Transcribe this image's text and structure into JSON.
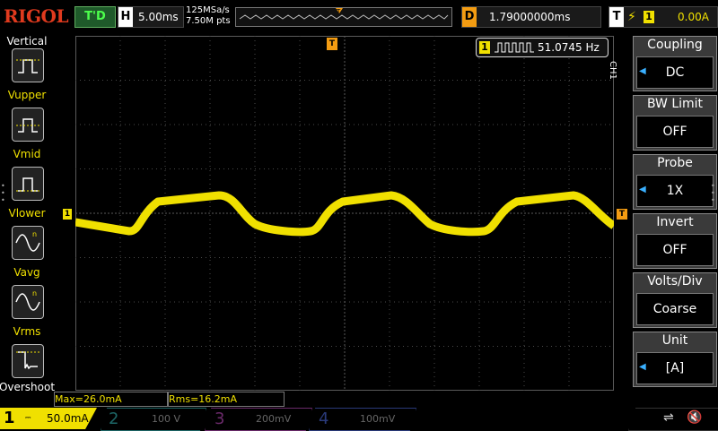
{
  "brand": "RIGOL",
  "trigger_state": "T'D",
  "horizontal": {
    "label": "H",
    "timebase": "5.00ms",
    "sample_rate": "125MSa/s",
    "memory": "7.50M pts"
  },
  "delay": {
    "label": "D",
    "value": "1.79000000ms"
  },
  "trigger": {
    "label": "T",
    "source": "1",
    "level": "0.00A"
  },
  "sidebar": {
    "title": "Vertical",
    "items": [
      {
        "label": "Vupper",
        "icon": "vupper-icon"
      },
      {
        "label": "Vmid",
        "icon": "vmid-icon"
      },
      {
        "label": "Vlower",
        "icon": "vlower-icon"
      },
      {
        "label": "Vavg",
        "icon": "vavg-icon"
      },
      {
        "label": "Vrms",
        "icon": "vrms-icon"
      },
      {
        "label": "Overshoot",
        "icon": "overshoot-icon"
      }
    ]
  },
  "frequency_readout": {
    "channel": "1",
    "value": "51.0745 Hz"
  },
  "channel_tag": "CH1",
  "menu": [
    {
      "title": "Coupling",
      "value": "DC",
      "arrow": true
    },
    {
      "title": "BW Limit",
      "value": "OFF",
      "arrow": false
    },
    {
      "title": "Probe",
      "value": "1X",
      "arrow": true
    },
    {
      "title": "Invert",
      "value": "OFF",
      "arrow": false
    },
    {
      "title": "Volts/Div",
      "value": "Coarse",
      "arrow": false
    },
    {
      "title": "Unit",
      "value": "[A]",
      "arrow": true
    }
  ],
  "measurements": {
    "max": "Max=26.0mA",
    "rms": "Rms=16.2mA"
  },
  "channels": [
    {
      "num": "1",
      "scale": "50.0mA",
      "color": "#f0e000"
    },
    {
      "num": "2",
      "scale": "100 V",
      "color": "#3ad0d0"
    },
    {
      "num": "3",
      "scale": "200mV",
      "color": "#e040e0"
    },
    {
      "num": "4",
      "scale": "100mV",
      "color": "#3a6ef0"
    }
  ],
  "colors": {
    "trace": "#f0e000",
    "trigger": "#f39c12",
    "grid": "#5a5a5a"
  }
}
